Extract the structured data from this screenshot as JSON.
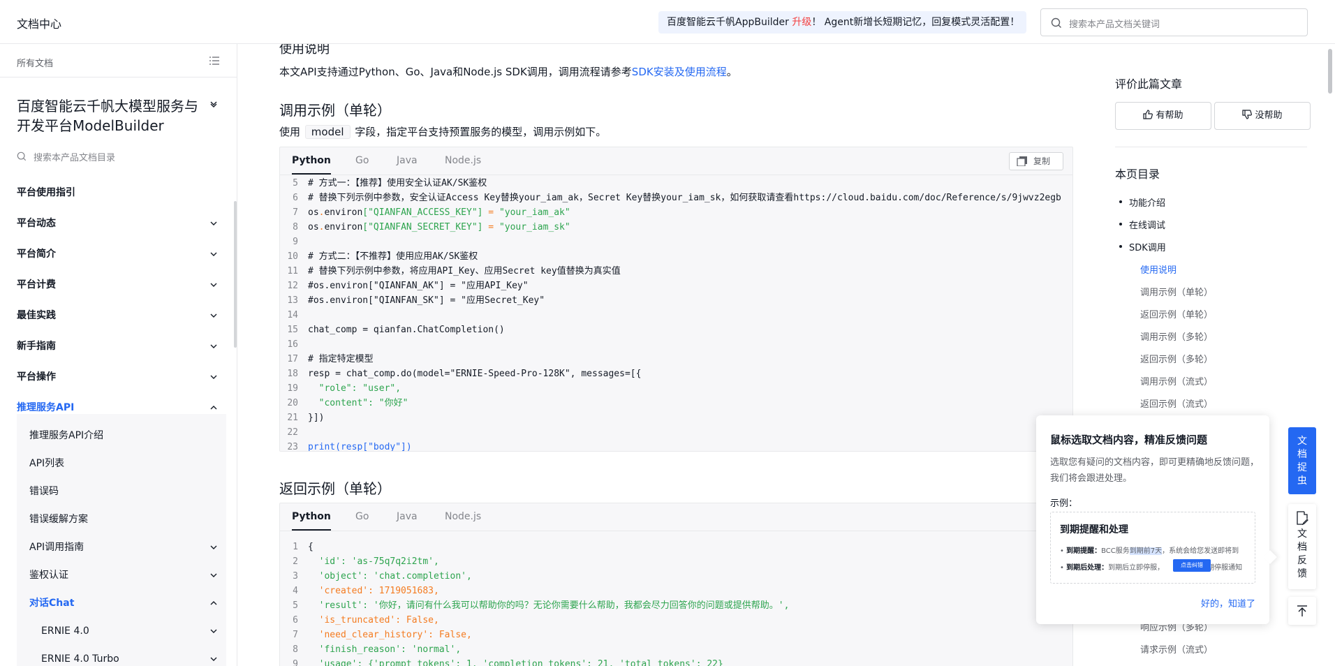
{
  "header": {
    "doc_center": "文档中心",
    "announce_pre": "百度智能云千帆AppBuilder ",
    "announce_up": "升级",
    "announce_post": "！ Agent新增长短期记忆，回复模式灵活配置！",
    "search_placeholder": "搜索本产品文档关键词"
  },
  "sidebar": {
    "all_docs": "所有文档",
    "product_title": "百度智能云千帆大模型服务与开发平台ModelBuilder",
    "search_placeholder": "搜索本产品文档目录",
    "items": [
      {
        "label": "平台使用指引"
      },
      {
        "label": "平台动态"
      },
      {
        "label": "平台简介"
      },
      {
        "label": "平台计费"
      },
      {
        "label": "最佳实践"
      },
      {
        "label": "新手指南"
      },
      {
        "label": "平台操作"
      },
      {
        "label": "推理服务API"
      }
    ],
    "sub_items": [
      {
        "label": "推理服务API介绍"
      },
      {
        "label": "API列表"
      },
      {
        "label": "错误码"
      },
      {
        "label": "错误缓解方案"
      },
      {
        "label": "API调用指南"
      },
      {
        "label": "鉴权认证"
      },
      {
        "label": "对话Chat"
      }
    ],
    "sub2_items": [
      {
        "label": "ERNIE 4.0"
      },
      {
        "label": "ERNIE 4.0 Turbo"
      }
    ]
  },
  "main": {
    "heading_top": "使用说明",
    "intro_text": "本文API支持通过Python、Go、Java和Node.js SDK调用，调用流程请参考",
    "intro_link": "SDK安装及使用流程",
    "intro_end": "。",
    "h2_call": "调用示例（单轮）",
    "call_desc_pre": "使用",
    "call_desc_code": "model",
    "call_desc_post": "字段，指定平台支持预置服务的模型，调用示例如下。",
    "h2_return": "返回示例（单轮）",
    "tabs": [
      "Python",
      "Go",
      "Java",
      "Node.js"
    ],
    "copy_label": "复制"
  },
  "code1": [
    {
      "n": "5",
      "t": "# 方式一：【推荐】使用安全认证AK/SK鉴权"
    },
    {
      "n": "6",
      "t": "# 替换下列示例中参数，安全认证Access Key替换your_iam_ak，Secret Key替换your_iam_sk，如何获取请查看https://cloud.baidu.com/doc/Reference/s/9jwvz2egb"
    },
    {
      "n": "7",
      "a": "os",
      "b": ".",
      "c": "environ",
      "d": "[\"QIANFAN_ACCESS_KEY\"]",
      "e": " = ",
      "f": "\"your_iam_ak\""
    },
    {
      "n": "8",
      "a": "os",
      "b": ".",
      "c": "environ",
      "d": "[\"QIANFAN_SECRET_KEY\"]",
      "e": " = ",
      "f": "\"your_iam_sk\""
    },
    {
      "n": "9",
      "t": ""
    },
    {
      "n": "10",
      "t": "# 方式二：【不推荐】使用应用AK/SK鉴权"
    },
    {
      "n": "11",
      "t": "# 替换下列示例中参数，将应用API_Key、应用Secret key值替换为真实值"
    },
    {
      "n": "12",
      "t": "#os.environ[\"QIANFAN_AK\"] = \"应用API_Key\""
    },
    {
      "n": "13",
      "t": "#os.environ[\"QIANFAN_SK\"] = \"应用Secret_Key\""
    },
    {
      "n": "14",
      "t": ""
    },
    {
      "n": "15",
      "t": "chat_comp = qianfan.ChatCompletion()"
    },
    {
      "n": "16",
      "t": ""
    },
    {
      "n": "17",
      "t": "# 指定特定模型"
    },
    {
      "n": "18",
      "t": "resp = chat_comp.do(model=\"ERNIE-Speed-Pro-128K\", messages=[{"
    },
    {
      "n": "19",
      "t": "  \"role\": \"user\","
    },
    {
      "n": "20",
      "t": "  \"content\": \"你好\""
    },
    {
      "n": "21",
      "t": "}])"
    },
    {
      "n": "22",
      "t": ""
    },
    {
      "n": "23",
      "t": "print(resp[\"body\"])"
    }
  ],
  "code2": [
    {
      "n": "1",
      "t": "{"
    },
    {
      "n": "2",
      "t": "  'id': 'as-75q7q2i2tm',"
    },
    {
      "n": "3",
      "t": "  'object': 'chat.completion',"
    },
    {
      "n": "4",
      "t": "  'created': 1719051683,"
    },
    {
      "n": "5",
      "t": "  'result': '你好，请问有什么我可以帮助你的吗？无论你需要什么帮助，我都会尽力回答你的问题或提供帮助。',"
    },
    {
      "n": "6",
      "t": "  'is_truncated': False,"
    },
    {
      "n": "7",
      "t": "  'need_clear_history': False,"
    },
    {
      "n": "8",
      "t": "  'finish_reason': 'normal',"
    },
    {
      "n": "9",
      "t": "  'usage': {'prompt_tokens': 1, 'completion_tokens': 21, 'total_tokens': 22}"
    }
  ],
  "right": {
    "rate_title": "评价此篇文章",
    "helpful": "有帮助",
    "not_helpful": "没帮助",
    "toc_title": "本页目录",
    "toc_l1": [
      "功能介绍",
      "在线调试",
      "SDK调用"
    ],
    "toc_l2": [
      "使用说明",
      "调用示例（单轮）",
      "返回示例（单轮）",
      "调用示例（多轮）",
      "返回示例（多轮）",
      "调用示例（流式）",
      "返回示例（流式）"
    ],
    "toc_bottom": [
      "响应示例（多轮）",
      "请求示例（流式）"
    ]
  },
  "popover": {
    "title": "鼠标选取文档内容，精准反馈问题",
    "desc": "选取您有疑问的文档内容，即可更精确地反馈问题，我们将会跟进处理。",
    "example_label": "示例：",
    "card_title": "到期提醒和处理",
    "row1_bold": "到期提醒：",
    "row1_pre": "BCC服务",
    "row1_hl": "到期前7天",
    "row1_post": "，系统会给您发送即将到",
    "row2_bold": "到期后处理：",
    "row2_pre": "到期后立即停服，",
    "row2_post": "期停服通知",
    "badge": "点击纠错",
    "ok": "好的，知道了"
  },
  "fab": {
    "bug": "文档捉虫",
    "feedback": "文档反馈"
  },
  "colors": {
    "accent": "#2468f2",
    "upgrade": "#f33e3e"
  }
}
